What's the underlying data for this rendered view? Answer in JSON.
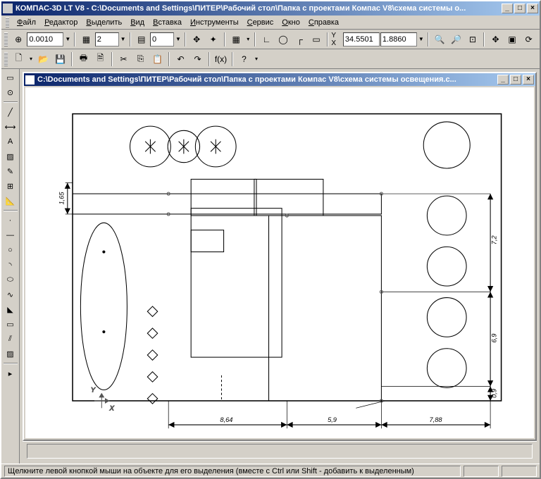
{
  "app": {
    "title": "КОМПАС-3D LT V8 - C:\\Documents and Settings\\ПИТЕР\\Рабочий стол\\Папка с проектами Компас V8\\схема системы о..."
  },
  "menu": {
    "file": "Файл",
    "editor": "Редактор",
    "select": "Выделить",
    "view": "Вид",
    "insert": "Вставка",
    "tools": "Инструменты",
    "service": "Сервис",
    "window": "Окно",
    "help": "Справка"
  },
  "toolbar1": {
    "coord_step": "0.0010",
    "layer_num": "2",
    "style_num": "0",
    "coord_label": "Y X",
    "coord_x": "34.5501",
    "coord_y": "1.8860"
  },
  "doc": {
    "title": "C:\\Documents and Settings\\ПИТЕР\\Рабочий стол\\Папка с проектами Компас V8\\схема системы освещения.c..."
  },
  "dims": {
    "left_v": "1,65",
    "right_v1": "7,2",
    "right_v2": "6,9",
    "right_v3": "0,9",
    "bot_h1": "8,64",
    "bot_h2": "5,9",
    "bot_h3": "7,88"
  },
  "status": {
    "hint": "Щелкните левой кнопкой мыши на объекте для его выделения (вместе с Ctrl или Shift - добавить к выделенным)"
  }
}
